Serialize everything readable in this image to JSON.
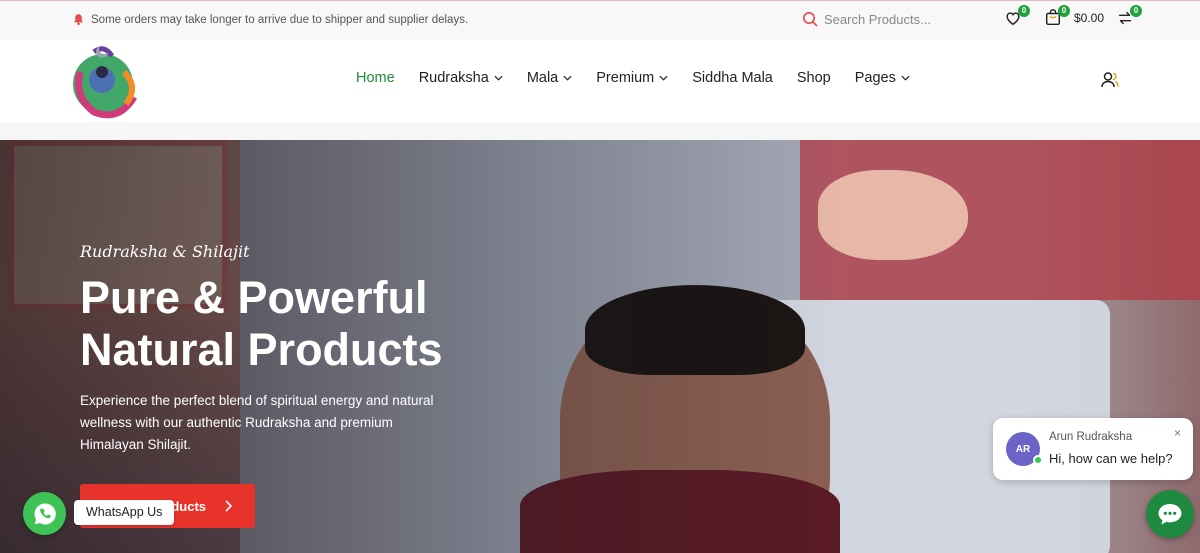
{
  "topbar": {
    "notice": "Some orders may take longer to arrive due to shipper and supplier delays.",
    "search_placeholder": "Search Products...",
    "wishlist_count": "0",
    "cart_count": "0",
    "cart_total": "$0.00",
    "compare_count": "0"
  },
  "header": {
    "logo_icon": "shiva-logo",
    "nav": [
      {
        "label": "Home",
        "active": true
      },
      {
        "label": "Rudraksha",
        "dropdown": true
      },
      {
        "label": "Mala",
        "dropdown": true
      },
      {
        "label": "Premium",
        "dropdown": true
      },
      {
        "label": "Siddha Mala"
      },
      {
        "label": "Shop"
      },
      {
        "label": "Pages",
        "dropdown": true
      }
    ]
  },
  "hero": {
    "tagline": "Rudraksha & Shilajit",
    "title_line1": "Pure & Powerful",
    "title_line2": "Natural Products",
    "description": "Experience the perfect blend of spiritual energy and natural wellness with our authentic Rudraksha and premium Himalayan Shilajit.",
    "button_label": "ducts"
  },
  "whatsapp": {
    "label": "WhatsApp Us"
  },
  "chat": {
    "avatar_initials": "AR",
    "agent_name": "Arun Rudraksha",
    "message": "Hi, how can we help?",
    "close": "×"
  },
  "colors": {
    "accent_green": "#1f8a3b",
    "button_red": "#e8332b",
    "whatsapp_green": "#3ec456"
  }
}
